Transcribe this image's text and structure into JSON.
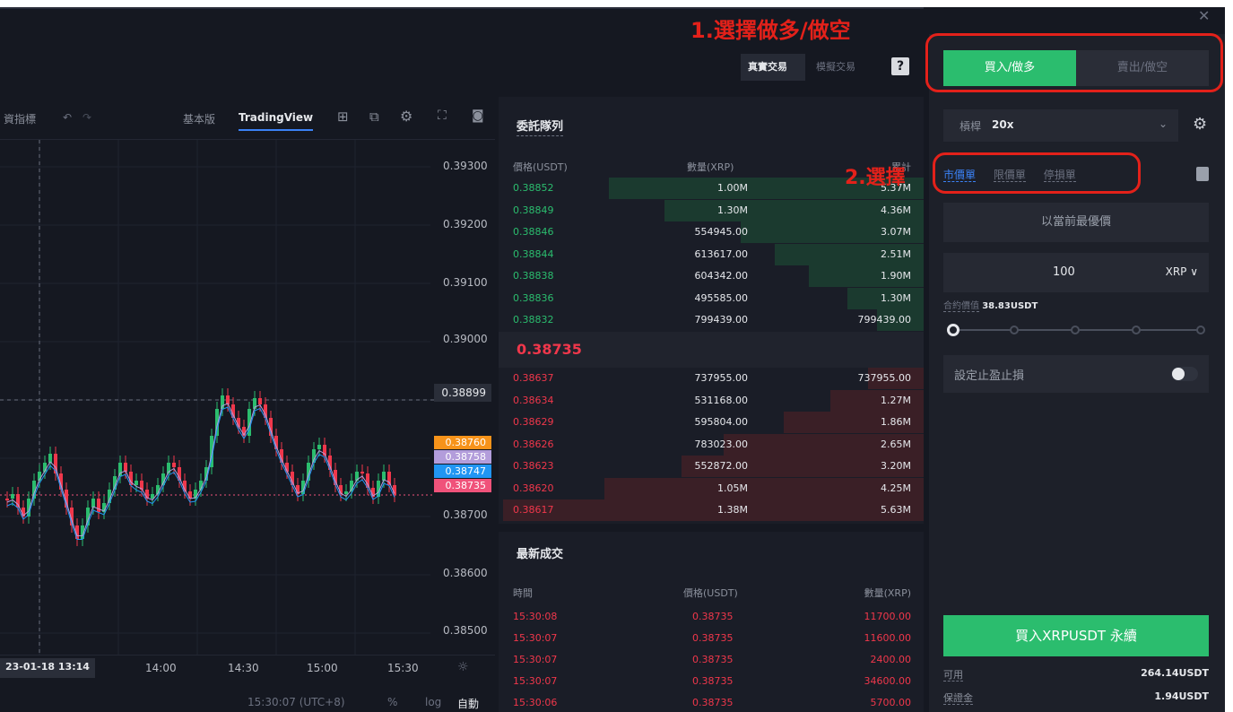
{
  "topbar": {
    "real_trade": "真實交易",
    "demo_trade": "模擬交易",
    "help": "?"
  },
  "chart_toolbar": {
    "indicator": "資指標",
    "basic": "基本版",
    "tradingview": "TradingView"
  },
  "chart": {
    "y_ticks": [
      "0.39300",
      "0.39200",
      "0.39100",
      "0.39000",
      "0.38899",
      "0.38700",
      "0.38600",
      "0.38500"
    ],
    "price_tags": [
      {
        "label": "0.38760",
        "color": "#f7931a"
      },
      {
        "label": "0.38758",
        "color": "#b39ddb"
      },
      {
        "label": "0.38747",
        "color": "#2196f3"
      },
      {
        "label": "0.38735",
        "color": "#f0527a"
      }
    ],
    "x_ticks": [
      "23-01-18  13:14",
      "14:00",
      "14:30",
      "15:00",
      "15:30"
    ],
    "time": "15:30:07 (UTC+8)",
    "percent": "%",
    "log": "log",
    "auto": "自動"
  },
  "orderbook": {
    "title": "委託隊列",
    "col_price": "價格(USDT)",
    "col_qty": "數量(XRP)",
    "col_total": "累計",
    "asks": [
      {
        "price": "0.38852",
        "qty": "1.00M",
        "total": "5.37M",
        "depth": 0.74
      },
      {
        "price": "0.38849",
        "qty": "1.30M",
        "total": "4.36M",
        "depth": 0.61
      },
      {
        "price": "0.38846",
        "qty": "554945.00",
        "total": "3.07M",
        "depth": 0.43
      },
      {
        "price": "0.38844",
        "qty": "613617.00",
        "total": "2.51M",
        "depth": 0.35
      },
      {
        "price": "0.38838",
        "qty": "604342.00",
        "total": "1.90M",
        "depth": 0.27
      },
      {
        "price": "0.38836",
        "qty": "495585.00",
        "total": "1.30M",
        "depth": 0.18
      },
      {
        "price": "0.38832",
        "qty": "799439.00",
        "total": "799439.00",
        "depth": 0.11
      }
    ],
    "last": "0.38735",
    "bids": [
      {
        "price": "0.38637",
        "qty": "737955.00",
        "total": "737955.00",
        "depth": 0.13
      },
      {
        "price": "0.38634",
        "qty": "531168.00",
        "total": "1.27M",
        "depth": 0.22
      },
      {
        "price": "0.38629",
        "qty": "595804.00",
        "total": "1.86M",
        "depth": 0.33
      },
      {
        "price": "0.38626",
        "qty": "783023.00",
        "total": "2.65M",
        "depth": 0.47
      },
      {
        "price": "0.38623",
        "qty": "552872.00",
        "total": "3.20M",
        "depth": 0.57
      },
      {
        "price": "0.38620",
        "qty": "1.05M",
        "total": "4.25M",
        "depth": 0.75
      },
      {
        "price": "0.38617",
        "qty": "1.38M",
        "total": "5.63M",
        "depth": 0.99
      }
    ]
  },
  "trades": {
    "title": "最新成交",
    "col_time": "時間",
    "col_price": "價格(USDT)",
    "col_qty": "數量(XRP)",
    "rows": [
      {
        "time": "15:30:08",
        "price": "0.38735",
        "qty": "11700.00"
      },
      {
        "time": "15:30:07",
        "price": "0.38735",
        "qty": "11600.00"
      },
      {
        "time": "15:30:07",
        "price": "0.38735",
        "qty": "2400.00"
      },
      {
        "time": "15:30:07",
        "price": "0.38735",
        "qty": "34600.00"
      },
      {
        "time": "15:30:06",
        "price": "0.38735",
        "qty": "5700.00"
      }
    ]
  },
  "panel": {
    "buy": "買入/做多",
    "sell": "賣出/做空",
    "leverage_label": "槓桿",
    "leverage_value": "20x",
    "types": [
      "市價單",
      "限價單",
      "停損單"
    ],
    "best_price": "以當前最優價",
    "qty_value": "100",
    "qty_unit": "XRP ∨",
    "contract_label": "合約價值",
    "contract_value": "38.83USDT",
    "tp_label": "設定止盈止損",
    "submit": "買入XRPUSDT 永續",
    "avail_label": "可用",
    "avail_value": "264.14USDT",
    "margin_label": "保證金",
    "margin_value": "1.94USDT"
  },
  "annotations": {
    "step1": "1.選擇做多/做空",
    "step2": "2.選擇"
  },
  "colors": {
    "buy": "#2bbd6e",
    "sell": "#f0374b",
    "annotation": "#e3211a"
  }
}
